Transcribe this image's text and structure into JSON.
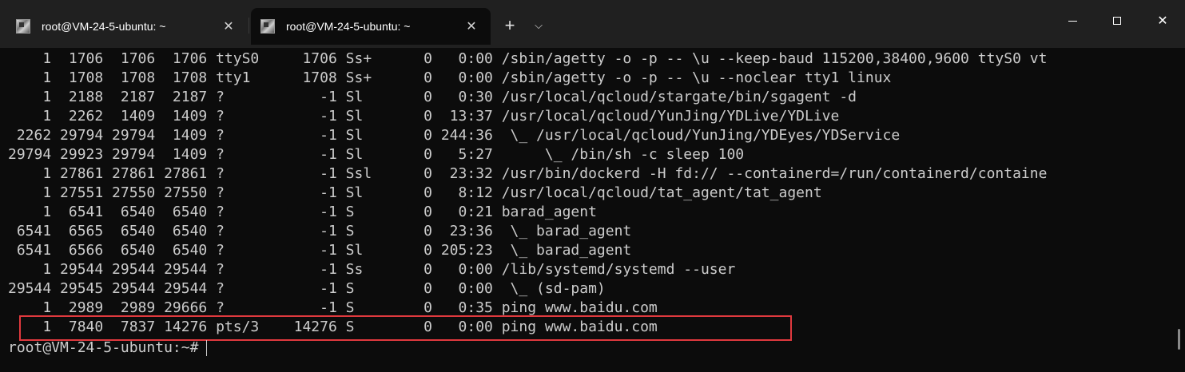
{
  "tabs": [
    {
      "title": "root@VM-24-5-ubuntu: ~",
      "active": false
    },
    {
      "title": "root@VM-24-5-ubuntu: ~",
      "active": true
    }
  ],
  "controls": {
    "new_tab": "+",
    "dropdown": "⌵",
    "close_tab": "✕",
    "window_close": "✕"
  },
  "terminal": {
    "lines": [
      "    1  1706  1706  1706 ttyS0     1706 Ss+      0   0:00 /sbin/agetty -o -p -- \\u --keep-baud 115200,38400,9600 ttyS0 vt",
      "    1  1708  1708  1708 tty1      1708 Ss+      0   0:00 /sbin/agetty -o -p -- \\u --noclear tty1 linux",
      "    1  2188  2187  2187 ?           -1 Sl       0   0:30 /usr/local/qcloud/stargate/bin/sgagent -d",
      "    1  2262  1409  1409 ?           -1 Sl       0  13:37 /usr/local/qcloud/YunJing/YDLive/YDLive",
      " 2262 29794 29794  1409 ?           -1 Sl       0 244:36  \\_ /usr/local/qcloud/YunJing/YDEyes/YDService",
      "29794 29923 29794  1409 ?           -1 Sl       0   5:27      \\_ /bin/sh -c sleep 100",
      "    1 27861 27861 27861 ?           -1 Ssl      0  23:32 /usr/bin/dockerd -H fd:// --containerd=/run/containerd/containe",
      "    1 27551 27550 27550 ?           -1 Sl       0   8:12 /usr/local/qcloud/tat_agent/tat_agent",
      "    1  6541  6540  6540 ?           -1 S        0   0:21 barad_agent",
      " 6541  6565  6540  6540 ?           -1 S        0  23:36  \\_ barad_agent",
      " 6541  6566  6540  6540 ?           -1 Sl       0 205:23  \\_ barad_agent",
      "    1 29544 29544 29544 ?           -1 Ss       0   0:00 /lib/systemd/systemd --user",
      "29544 29545 29544 29544 ?           -1 S        0   0:00  \\_ (sd-pam)",
      "    1  2989  2989 29666 ?           -1 S        0   0:35 ping www.baidu.com",
      "    1  7840  7837 14276 pts/3    14276 S        0   0:00 ping www.baidu.com"
    ],
    "prompt": "root@VM-24-5-ubuntu:~#",
    "highlight_color": "#e0393e"
  }
}
